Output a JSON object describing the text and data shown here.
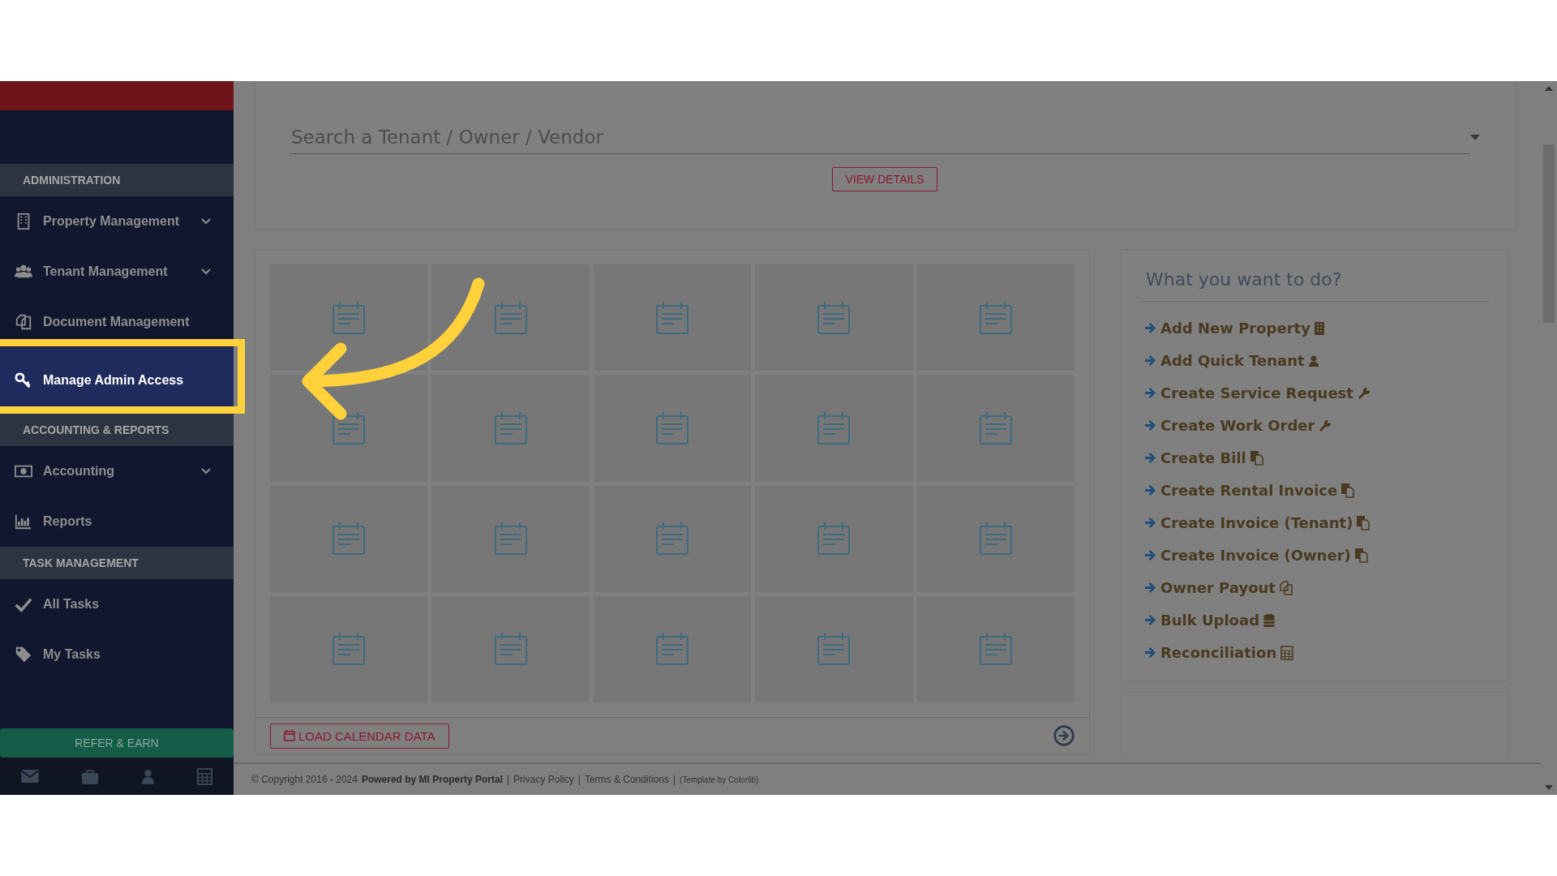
{
  "sidebar": {
    "sections": [
      {
        "title": "ADMINISTRATION",
        "items": [
          {
            "label": "Property Management",
            "kind": "dropdown",
            "selected": false
          },
          {
            "label": "Tenant Management",
            "kind": "dropdown",
            "selected": false
          },
          {
            "label": "Document Management",
            "kind": "link",
            "selected": false
          },
          {
            "label": "Manage Admin Access",
            "kind": "link",
            "selected": true
          }
        ]
      },
      {
        "title": "ACCOUNTING & REPORTS",
        "items": [
          {
            "label": "Accounting",
            "kind": "dropdown",
            "selected": false
          },
          {
            "label": "Reports",
            "kind": "link",
            "selected": false
          }
        ]
      },
      {
        "title": "TASK MANAGEMENT",
        "items": [
          {
            "label": "All Tasks",
            "kind": "link",
            "selected": false
          },
          {
            "label": "My Tasks",
            "kind": "link",
            "selected": false
          }
        ]
      }
    ],
    "refer_button": "REFER & EARN"
  },
  "search": {
    "placeholder": "Search a Tenant / Owner / Vendor",
    "button": "VIEW DETAILS"
  },
  "calendar": {
    "load_button": "LOAD CALENDAR DATA"
  },
  "actions": {
    "title": "What you want to do?",
    "items": [
      "Add New Property",
      "Add Quick Tenant",
      "Create Service Request",
      "Create Work Order",
      "Create Bill",
      "Create Rental Invoice",
      "Create Invoice (Tenant)",
      "Create Invoice (Owner)",
      "Owner Payout",
      "Bulk Upload",
      "Reconciliation"
    ]
  },
  "footer": {
    "parts": [
      {
        "kind": "text",
        "text": "© Copyright 2016 - 2024"
      },
      {
        "kind": "bold",
        "text": "Powered by MI Property Portal"
      },
      {
        "kind": "sep",
        "text": "|"
      },
      {
        "kind": "link",
        "text": "Privacy Policy"
      },
      {
        "kind": "sep",
        "text": "|"
      },
      {
        "kind": "link",
        "text": "Terms & Conditions"
      },
      {
        "kind": "sep",
        "text": "|"
      },
      {
        "kind": "small",
        "text": "(Template by Colorlib)"
      }
    ]
  }
}
